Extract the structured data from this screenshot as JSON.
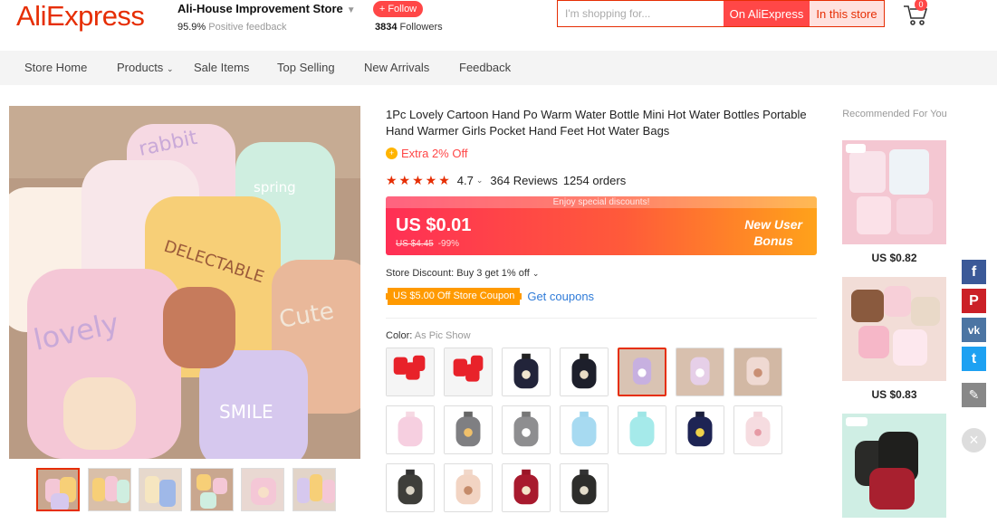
{
  "header": {
    "logo": "AliExpress",
    "store_name": "Ali-House Improvement Store",
    "feedback_value": "95.9%",
    "feedback_label": "Positive feedback",
    "follow_label": "+ Follow",
    "followers_count": "3834",
    "followers_label": "Followers",
    "search_placeholder": "I'm shopping for...",
    "search_on_ae": "On AliExpress",
    "search_in_store": "In this store",
    "cart_count": "0"
  },
  "nav": {
    "items": [
      "Store Home",
      "Products",
      "Sale Items",
      "Top Selling",
      "New Arrivals",
      "Feedback"
    ]
  },
  "product": {
    "title": "1Pc Lovely Cartoon Hand Po Warm Water Bottle Mini Hot Water Bottles Portable Hand Warmer Girls Pocket Hand Feet Hot Water Bags",
    "extra_off": "Extra 2% Off",
    "rating": "4.7",
    "stars": "★★★★★",
    "reviews": "364 Reviews",
    "orders": "1254 orders",
    "price_banner": "Enjoy special discounts!",
    "price_now": "US $0.01",
    "price_old": "US $4.45",
    "discount": "-99%",
    "new_user_line1": "New User",
    "new_user_line2": "Bonus",
    "store_discount": "Store Discount: Buy 3 get 1% off",
    "coupon_chip": "US $5.00 Off Store Coupon",
    "get_coupons": "Get coupons",
    "color_label": "Color:",
    "color_value": "As Pic Show"
  },
  "recommended": {
    "title": "Recommended For You",
    "prices": [
      "US $0.82",
      "US $0.83"
    ]
  },
  "colors": {
    "accent": "#e62e04",
    "brand_red": "#ff4747",
    "link_blue": "#2f7bd8"
  },
  "social": [
    "f",
    "P",
    "vk",
    "t",
    "✎"
  ]
}
